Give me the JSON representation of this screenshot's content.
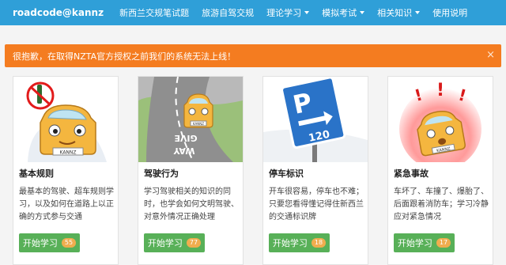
{
  "navbar": {
    "brand": "roadcode@kannz",
    "items": [
      {
        "label": "新西兰交规笔试题",
        "dropdown": false
      },
      {
        "label": "旅游自驾交规",
        "dropdown": false
      },
      {
        "label": "理论学习",
        "dropdown": true
      },
      {
        "label": "模拟考试",
        "dropdown": true
      },
      {
        "label": "相关知识",
        "dropdown": true
      },
      {
        "label": "使用说明",
        "dropdown": false
      }
    ]
  },
  "alert": {
    "message": "很抱歉，在取得NZTA官方授权之前我们的系统无法上线！",
    "close": "×"
  },
  "cards": [
    {
      "title": "基本规则",
      "desc": "最基本的驾驶、超车规则学习，以及如何在道路上以正确的方式参与交通",
      "button": "开始学习",
      "count": "55",
      "plate": "KANNZ"
    },
    {
      "title": "驾驶行为",
      "desc": "学习驾驶相关的知识的同时，也学会如何文明驾驶、对意外情况正确处理",
      "button": "开始学习",
      "count": "77",
      "plate": "KANNZ",
      "road_text_1": "GIVE",
      "road_text_2": "WAY"
    },
    {
      "title": "停车标识",
      "desc": "开车很容易，停车也不难；只要您看得懂记得住新西兰的交通标识牌",
      "button": "开始学习",
      "count": "18",
      "sign_letter": "P",
      "sign_number": "120"
    },
    {
      "title": "紧急事故",
      "desc": "车坏了、车撞了、爆胎了、后面跟着消防车；学习冷静应对紧急情况",
      "button": "开始学习",
      "count": "17",
      "plate": "KANNZ",
      "exclaim": "!"
    }
  ],
  "colors": {
    "navbar": "#2f9fd8",
    "alert": "#f47c20",
    "button": "#58b058",
    "badge": "#f0ad4e"
  }
}
